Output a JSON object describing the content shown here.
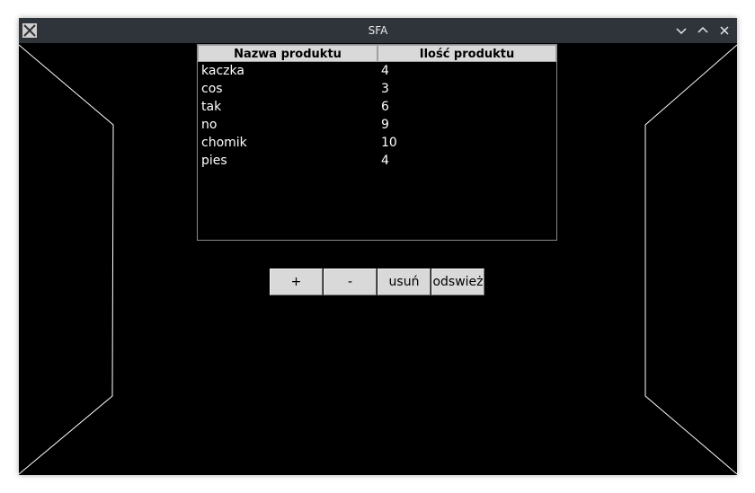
{
  "window": {
    "title": "SFA",
    "controls": [
      "minimize-chevron-icon",
      "maximize-chevron-icon",
      "close-icon"
    ]
  },
  "table": {
    "headers": [
      "Nazwa produktu",
      "Ilość produktu"
    ],
    "rows": [
      [
        "kaczka",
        "4"
      ],
      [
        "cos",
        "3"
      ],
      [
        "tak",
        "6"
      ],
      [
        "no",
        "9"
      ],
      [
        "chomik",
        "10"
      ],
      [
        "pies",
        "4"
      ]
    ]
  },
  "buttons": {
    "add_label": "+",
    "subtract_label": "-",
    "delete_label": "usuń",
    "refresh_label": "odswież"
  },
  "colors": {
    "background": "#000000",
    "titlebar": "#2f343a",
    "button_face": "#d9d9d9",
    "header_face": "#d9d9d9"
  }
}
